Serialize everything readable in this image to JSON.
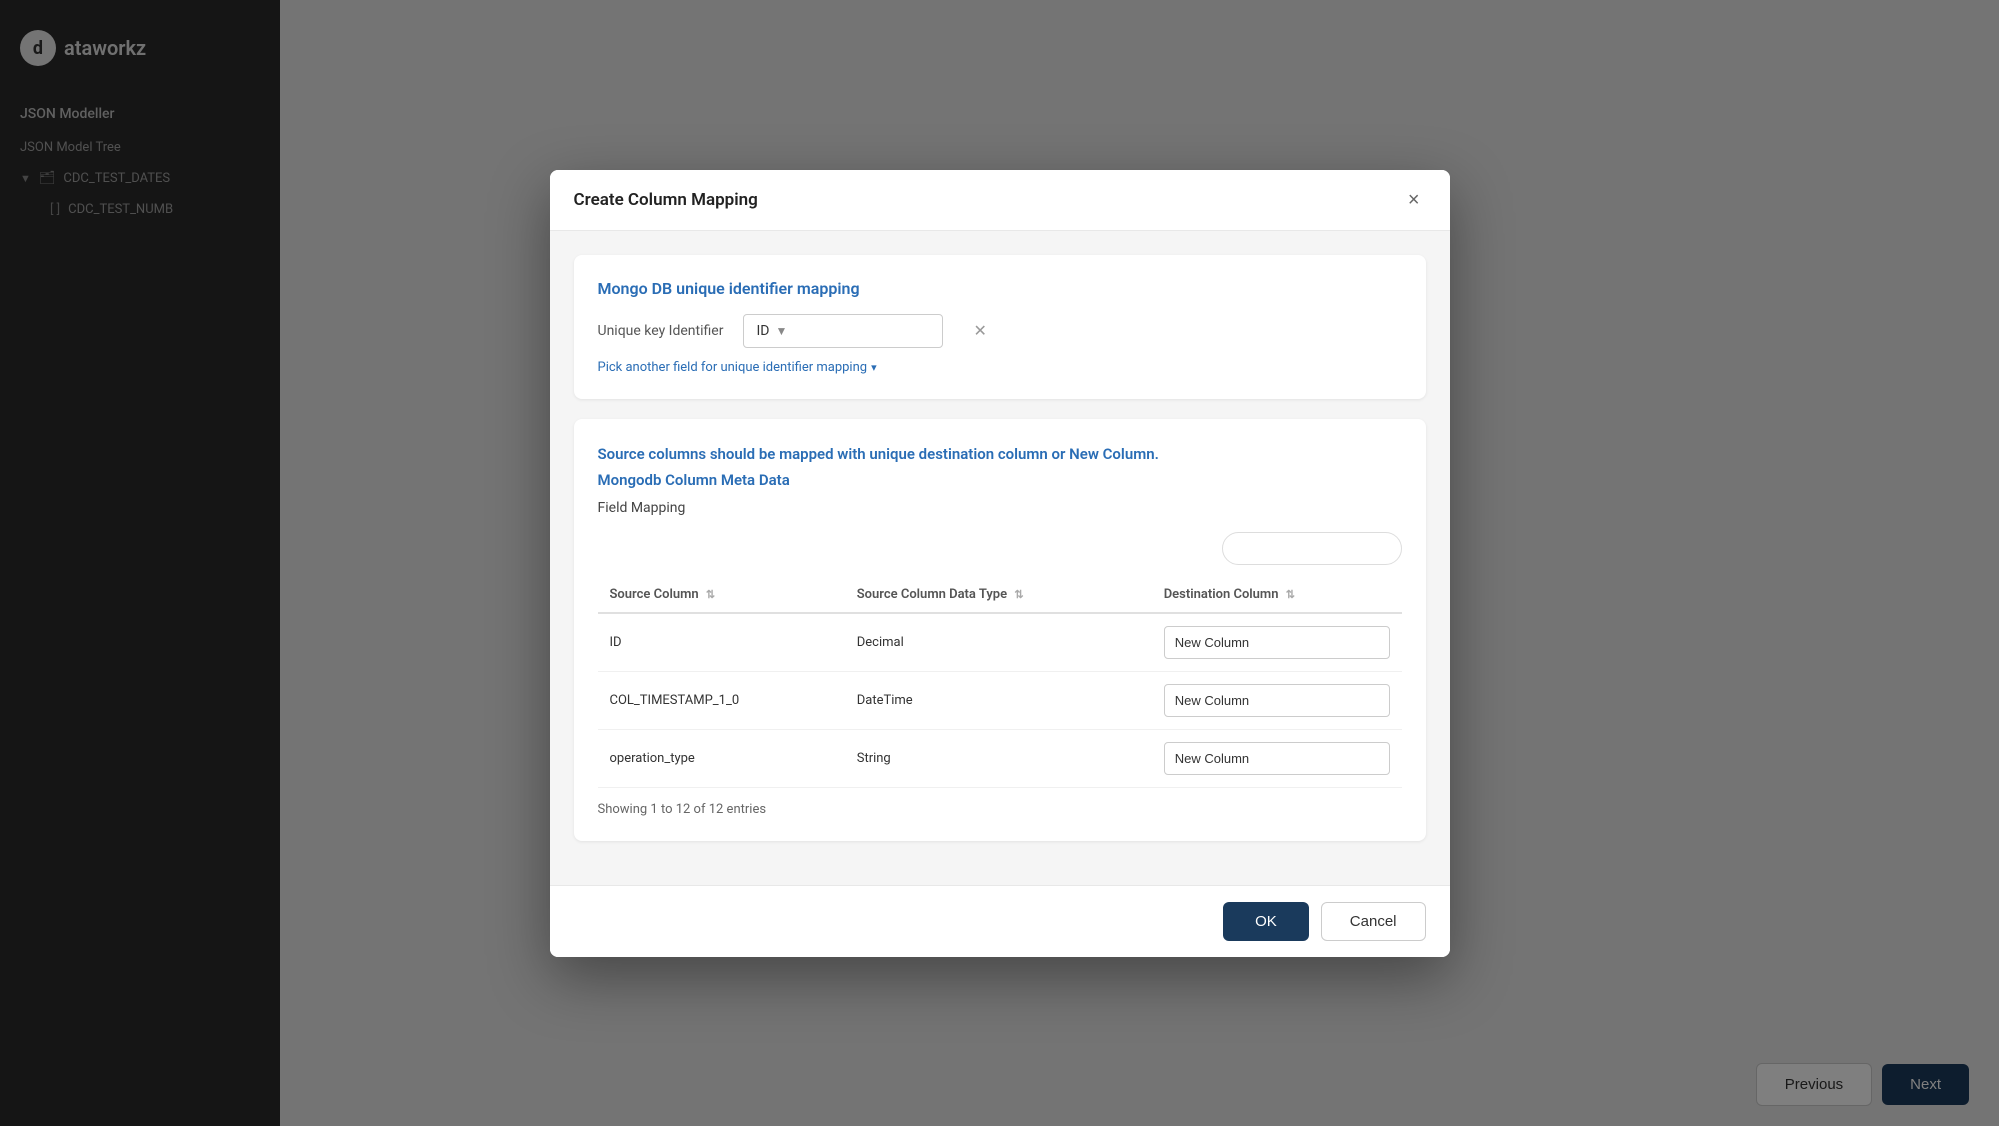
{
  "app": {
    "logo_text": "ataworkz",
    "sidebar_title": "JSON Modeller",
    "tree_label": "JSON Model Tree",
    "tree_items": [
      {
        "name": "CDC_TEST_DATES",
        "icon": "folder",
        "expanded": true
      },
      {
        "name": "CDC_TEST_NUMB",
        "icon": "bracket",
        "expanded": false
      }
    ]
  },
  "pagination": {
    "previous_label": "Previous",
    "next_label": "Next"
  },
  "modal": {
    "title": "Create Column Mapping",
    "close_icon": "×",
    "section1": {
      "title": "Mongo DB unique identifier mapping",
      "unique_key_label": "Unique key Identifier",
      "id_value": "ID",
      "pick_another_text": "Pick another field for unique identifier mapping"
    },
    "section2": {
      "title_line1": "Source columns should be mapped with unique destination column or New Column.",
      "title_line2": "Mongodb Column Meta Data",
      "field_mapping_label": "Field Mapping",
      "search_placeholder": "",
      "table": {
        "headers": [
          {
            "label": "Source Column",
            "sortable": true
          },
          {
            "label": "Source Column Data Type",
            "sortable": true
          },
          {
            "label": "Destination Column",
            "sortable": true
          }
        ],
        "rows": [
          {
            "source_col": "ID",
            "data_type": "Decimal",
            "destination": "New Column"
          },
          {
            "source_col": "COL_TIMESTAMP_1_0",
            "data_type": "DateTime",
            "destination": "New Column"
          },
          {
            "source_col": "operation_type",
            "data_type": "String",
            "destination": "New Column"
          }
        ]
      },
      "showing_text": "Showing 1 to 12 of 12 entries"
    },
    "footer": {
      "ok_label": "OK",
      "cancel_label": "Cancel"
    }
  }
}
